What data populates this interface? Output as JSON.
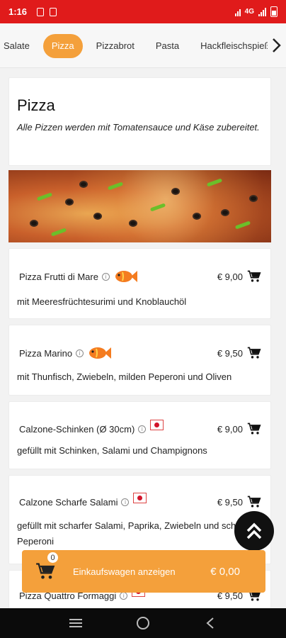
{
  "status_bar": {
    "time": "1:16",
    "network": "4G"
  },
  "tabs": [
    {
      "label": "Salate",
      "active": false
    },
    {
      "label": "Pizza",
      "active": true
    },
    {
      "label": "Pizzabrot",
      "active": false
    },
    {
      "label": "Pasta",
      "active": false
    },
    {
      "label": "Hackfleischspieß",
      "active": false
    }
  ],
  "category": {
    "title": "Pizza",
    "description": "Alle Pizzen werden mit Tomatensauce und Käse zubereitet."
  },
  "items": [
    {
      "name": "Pizza Frutti di Mare",
      "price": "€ 9,00",
      "description": "mit Meeresfrüchtesurimi und Knoblauchöl",
      "badge": "fish-icon"
    },
    {
      "name": "Pizza Marino",
      "price": "€ 9,50",
      "description": "mit Thunfisch, Zwiebeln, milden Peperoni und Oliven",
      "badge": "fish-icon"
    },
    {
      "name": "Calzone-Schinken (Ø 30cm)",
      "price": "€ 9,00",
      "description": "gefüllt mit Schinken, Salami und Champignons",
      "badge": "pork-flag-icon"
    },
    {
      "name": "Calzone Scharfe Salami",
      "price": "€ 9,50",
      "description": "gefüllt mit scharfer Salami, Paprika, Zwiebeln und scharfer Peperoni",
      "badge": "pork-flag-icon"
    },
    {
      "name": "Pizza Quattro Formaggi",
      "price": "€ 9,50",
      "description": "",
      "badge": "pork-flag-icon"
    }
  ],
  "cart": {
    "count": "0",
    "label": "Einkaufswagen anzeigen",
    "total": "€ 0,00"
  },
  "colors": {
    "accent": "#f4a03b",
    "status_bar": "#e01b1b"
  }
}
